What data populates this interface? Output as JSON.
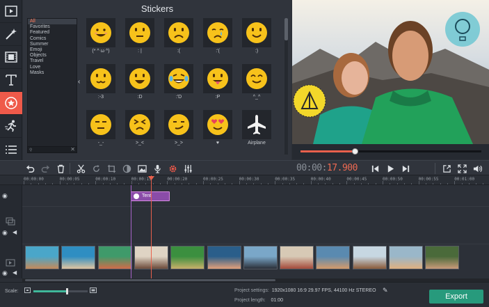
{
  "rail": {
    "items": [
      {
        "name": "import",
        "icon": "film-import-icon"
      },
      {
        "name": "filters",
        "icon": "magic-wand-icon"
      },
      {
        "name": "transitions",
        "icon": "film-frames-icon"
      },
      {
        "name": "titles",
        "icon": "text-icon"
      },
      {
        "name": "stickers",
        "icon": "star-badge-icon",
        "active": true
      },
      {
        "name": "motion",
        "icon": "running-man-icon"
      },
      {
        "name": "more",
        "icon": "list-icon"
      }
    ]
  },
  "stickers": {
    "title": "Stickers",
    "categories": [
      "All",
      "Favorites",
      "Featured",
      "Comics",
      "Summer",
      "Emoji",
      "Objects",
      "Travel",
      "Love",
      "Masks"
    ],
    "selected_category": "All",
    "items": [
      {
        "label": "(* ^ ω ^)",
        "face": "grin"
      },
      {
        "label": ": |",
        "face": "neutral"
      },
      {
        "label": ":(",
        "face": "sad"
      },
      {
        "label": ":'(",
        "face": "cry"
      },
      {
        "label": ":)",
        "face": "smile"
      },
      {
        "label": ":-3",
        "face": "cat"
      },
      {
        "label": ":D",
        "face": "laugh"
      },
      {
        "label": ":'D",
        "face": "tears-joy"
      },
      {
        "label": ":P",
        "face": "tongue"
      },
      {
        "label": "^_^",
        "face": "happy"
      },
      {
        "label": "-_-",
        "face": "meh"
      },
      {
        "label": ">_<",
        "face": "squint"
      },
      {
        "label": ">_>",
        "face": "smirk"
      },
      {
        "label": "♥",
        "face": "heart-eyes"
      },
      {
        "label": "Airplane",
        "face": "airplane"
      }
    ]
  },
  "preview": {
    "progress": 0.3
  },
  "toolbar": {
    "timecode_prefix": "00:00:",
    "timecode_value": "17.900",
    "icons": [
      "undo-icon",
      "redo-icon",
      "trash-icon",
      "cut-icon",
      "rotate-icon",
      "crop-icon",
      "color-icon",
      "image-icon",
      "mic-icon",
      "gear-icon",
      "equalizer-icon",
      "skip-back-icon",
      "play-icon",
      "skip-forward-icon",
      "export-frame-icon",
      "fullscreen-icon",
      "volume-icon"
    ]
  },
  "timeline": {
    "ticks": [
      "00:00:00",
      "00:00:05",
      "00:00:10",
      "00:00:15",
      "00:00:20",
      "00:00:25",
      "00:00:30",
      "00:00:35",
      "00:00:40",
      "00:00:45",
      "00:00:50",
      "00:00:55",
      "00:01:00"
    ],
    "sticker_clip": {
      "label": "Tent"
    }
  },
  "status": {
    "scale_label": "Scale:",
    "scale_value": 0.62,
    "settings_label": "Project settings:",
    "settings_value": "1920x1080 16:9 29.97 FPS, 44100 Hz STEREO",
    "length_label": "Project length:",
    "length_value": "01:00",
    "export_label": "Export"
  },
  "colors": {
    "accent": "#e8604c",
    "export": "#279a7c",
    "sticker_clip": "#8a4ca8",
    "emoji": "#f7c21b"
  }
}
